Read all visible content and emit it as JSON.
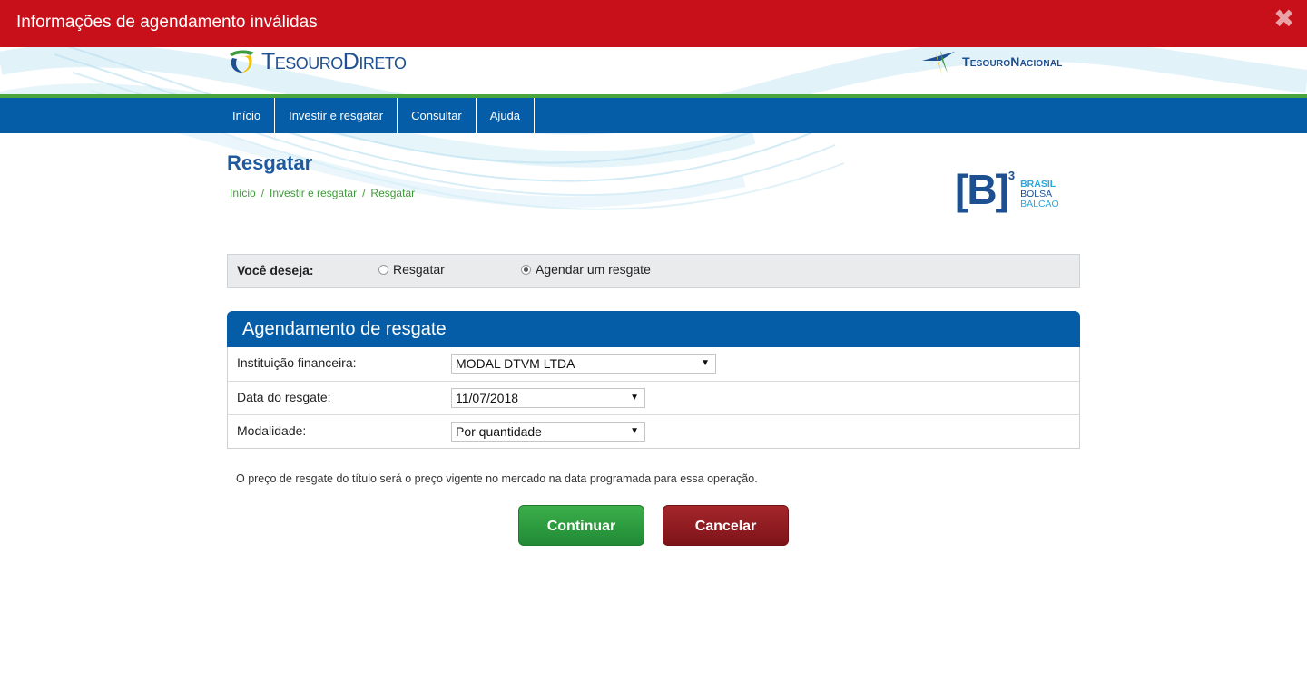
{
  "alert": {
    "message": "Informações de agendamento inválidas",
    "close_glyph": "✖"
  },
  "header": {
    "logo_left": {
      "text": "TesouroDireto",
      "icon": "tesouro-direto-logo-icon"
    },
    "logo_right": {
      "text": "TesouroNacional",
      "icon": "tesouro-nacional-logo-icon"
    }
  },
  "nav": {
    "items": [
      "Início",
      "Investir e resgatar",
      "Consultar",
      "Ajuda"
    ]
  },
  "page": {
    "title": "Resgatar",
    "breadcrumb": [
      "Início",
      "Investir e resgatar",
      "Resgatar"
    ],
    "breadcrumb_sep": "/"
  },
  "b3": {
    "mark": "[B]",
    "sup": "3",
    "words": [
      "BRASIL",
      "BOLSA",
      "BALCÃO"
    ]
  },
  "choice": {
    "label": "Você deseja:",
    "options": [
      {
        "label": "Resgatar",
        "checked": false
      },
      {
        "label": "Agendar um resgate",
        "checked": true
      }
    ]
  },
  "panel": {
    "title": "Agendamento de resgate",
    "rows": [
      {
        "label": "Instituição financeira:",
        "value": "MODAL DTVM LTDA"
      },
      {
        "label": "Data do resgate:",
        "value": "11/07/2018"
      },
      {
        "label": "Modalidade:",
        "value": "Por quantidade"
      }
    ]
  },
  "note": "O preço de resgate do título será o preço vigente no mercado na data programada para essa operação.",
  "buttons": {
    "continue": "Continuar",
    "cancel": "Cancelar"
  },
  "colors": {
    "alert": "#c8101a",
    "nav": "#065da7",
    "green_line": "#4aa63c",
    "continue": "#2a9a3d",
    "cancel": "#8e1b20"
  }
}
